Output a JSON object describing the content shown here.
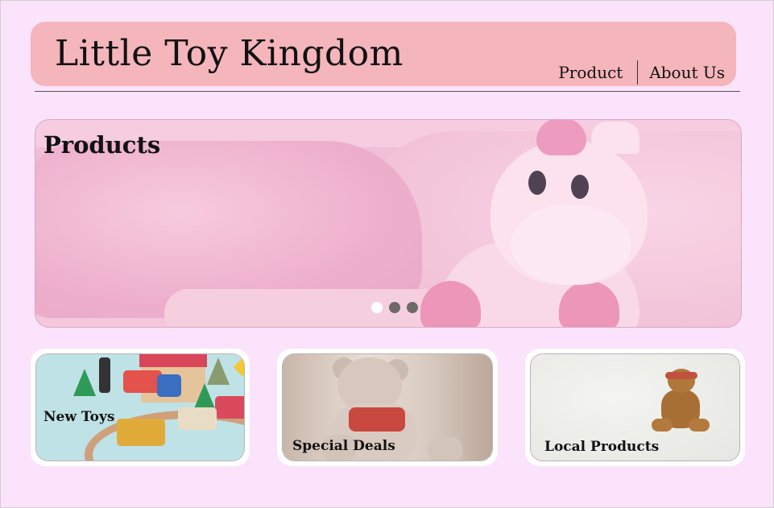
{
  "header": {
    "brand": "Little Toy Kingdom",
    "nav": [
      {
        "label": "Product"
      },
      {
        "label": "About Us"
      }
    ]
  },
  "banner": {
    "title": "Products",
    "carousel": {
      "slide_count": 3,
      "active_index": 0
    }
  },
  "cards": [
    {
      "label": "New Toys"
    },
    {
      "label": "Special Deals"
    },
    {
      "label": "Local Products"
    }
  ],
  "colors": {
    "background": "#fbe3fb",
    "header": "#f4b5bb",
    "dot_active": "#ffffff",
    "dot_inactive": "#6e6a6a"
  }
}
